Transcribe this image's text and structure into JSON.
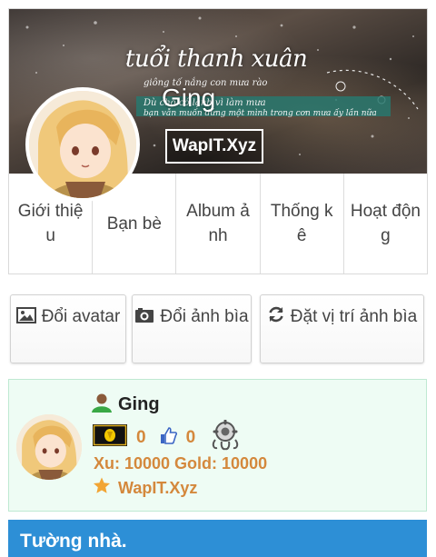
{
  "profile": {
    "display_name": "Ging",
    "site_badge": "WapIT.Xyz",
    "cover_caption": {
      "main": "tuổi thanh xuân",
      "line1": "giông tố nắng con mưa rào",
      "line2": "Dù cho có lạnh vì làm mưa",
      "line3": "bạn vẫn muốn đứng một mình trong cơn mưa ấy lần nữa"
    }
  },
  "tabs": [
    {
      "label": "Giới thiệu"
    },
    {
      "label": "Bạn bè"
    },
    {
      "label": "Album ảnh"
    },
    {
      "label": "Thống kê"
    },
    {
      "label": "Hoạt động"
    }
  ],
  "actions": {
    "change_avatar": "Đổi avatar",
    "change_cover": "Đổi ảnh bìa",
    "set_cover_position": "Đặt vị trí ảnh bìa"
  },
  "info": {
    "username": "Ging",
    "stat_posts": "0",
    "stat_likes": "0",
    "money": "Xu: 10000 Gold: 10000",
    "site": "WapIT.Xyz"
  },
  "section": {
    "wall_title": "Tường nhà."
  },
  "icons": {
    "user": "user-icon",
    "trophy": "medal-icon",
    "like": "thumbs-up-icon",
    "gear": "gear-icon",
    "star": "star-icon",
    "image": "image-icon",
    "camera": "camera-icon",
    "refresh": "refresh-icon"
  },
  "colors": {
    "accent_blue": "#2d8fd6",
    "orange_text": "#d4883c",
    "info_bg": "#eefcf4"
  }
}
